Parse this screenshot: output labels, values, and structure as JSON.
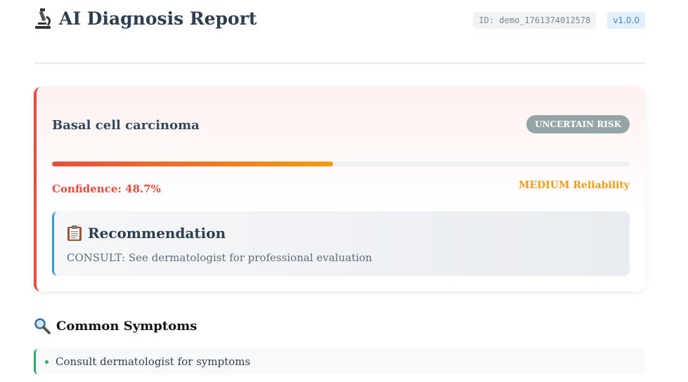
{
  "header": {
    "title": "AI Diagnosis Report",
    "title_icon": "microscope-icon",
    "id_label": "ID: demo_1761374012578",
    "version": "v1.0.0"
  },
  "diagnosis": {
    "name": "Basal cell carcinoma",
    "risk_badge": "UNCERTAIN RISK",
    "confidence_label": "Confidence: 48.7%",
    "confidence_value": 48.7,
    "reliability": "MEDIUM Reliability",
    "colors": {
      "accent": "#e74c3c",
      "reliability": "#f39c12",
      "risk_badge_bg": "#95a5a6"
    }
  },
  "recommendation": {
    "title": "Recommendation",
    "icon": "clipboard-icon",
    "text": "CONSULT: See dermatologist for professional evaluation"
  },
  "symptoms": {
    "title": "Common Symptoms",
    "icon": "magnifier-icon",
    "items": [
      "Consult dermatologist for symptoms"
    ]
  }
}
